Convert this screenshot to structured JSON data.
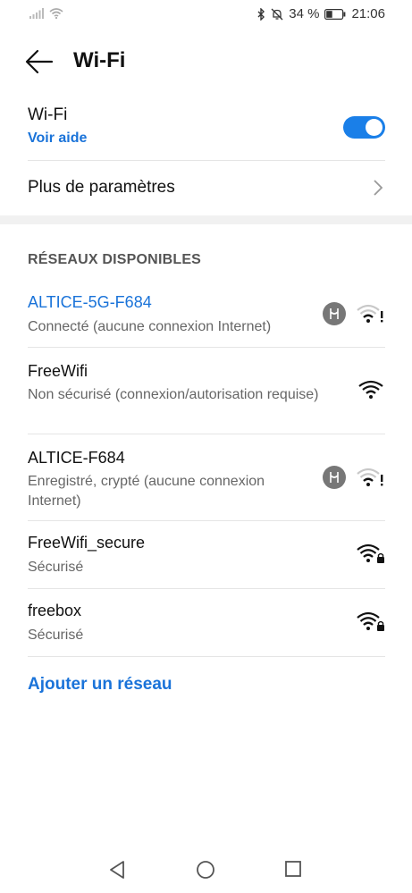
{
  "status_bar": {
    "battery_text": "34 %",
    "time": "21:06",
    "icons": [
      "signal-icon",
      "wifi-icon",
      "bluetooth-icon",
      "notifications-muted-icon",
      "battery-icon"
    ]
  },
  "header": {
    "title": "Wi-Fi"
  },
  "wifi_toggle": {
    "label": "Wi-Fi",
    "help_link": "Voir aide",
    "enabled": true,
    "accent_color": "#1a7fe8"
  },
  "more_settings": {
    "label": "Plus de paramètres"
  },
  "section": {
    "title": "RÉSEAUX DISPONIBLES"
  },
  "networks": [
    {
      "name": "ALTICE-5G-F684",
      "status": "Connecté (aucune connexion Internet)",
      "connected": true,
      "icons": [
        "hotspot-icon",
        "wifi-warning-icon"
      ]
    },
    {
      "name": "FreeWifi",
      "status": "Non sécurisé (connexion/autorisation requise)",
      "connected": false,
      "icons": [
        "wifi-icon"
      ]
    },
    {
      "name": "ALTICE-F684",
      "status": "Enregistré, crypté (aucune connexion Internet)",
      "connected": false,
      "icons": [
        "hotspot-icon",
        "wifi-warning-icon"
      ]
    },
    {
      "name": "FreeWifi_secure",
      "status": "Sécurisé",
      "connected": false,
      "icons": [
        "wifi-lock-icon"
      ]
    },
    {
      "name": "freebox",
      "status": "Sécurisé",
      "connected": false,
      "icons": [
        "wifi-lock-icon"
      ]
    }
  ],
  "add_network": {
    "label": "Ajouter un réseau"
  },
  "nav": {
    "icons": [
      "back-triangle-icon",
      "home-circle-icon",
      "recents-square-icon"
    ]
  }
}
